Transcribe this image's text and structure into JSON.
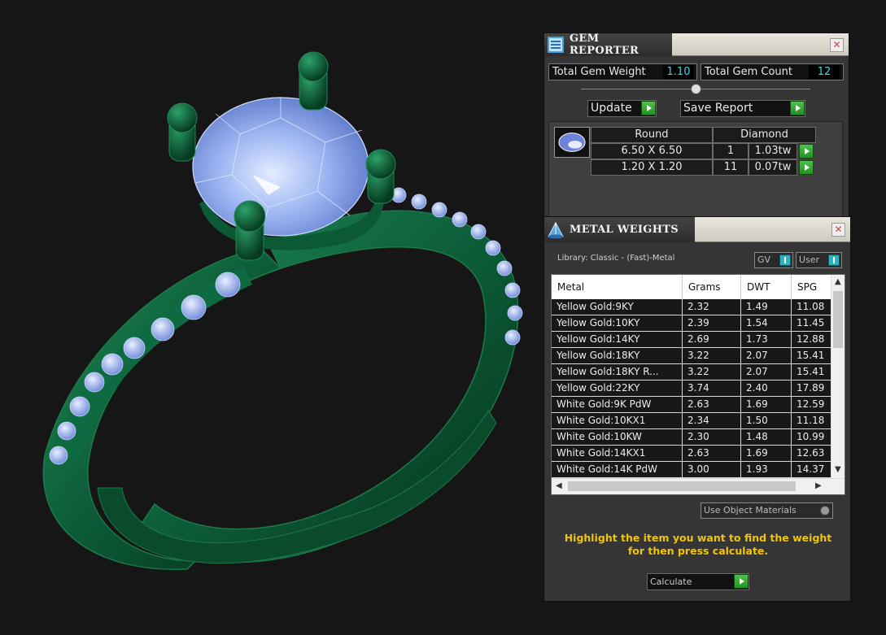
{
  "gem_reporter": {
    "title": "GEM REPORTER",
    "total_weight_label": "Total Gem Weight",
    "total_weight_value": "1.10",
    "total_count_label": "Total Gem Count",
    "total_count_value": "12",
    "update_label": "Update",
    "save_report_label": "Save Report",
    "stone_shape": "Round",
    "stone_type": "Diamond",
    "rows": [
      {
        "size": "6.50 X 6.50",
        "count": "1",
        "weight": "1.03tw"
      },
      {
        "size": "1.20 X 1.20",
        "count": "11",
        "weight": "0.07tw"
      }
    ]
  },
  "metal_weights": {
    "title": "METAL WEIGHTS",
    "library": "Library: Classic - (Fast)-Metal",
    "gv_label": "GV",
    "user_label": "User",
    "columns": [
      "Metal",
      "Grams",
      "DWT",
      "SPG"
    ],
    "rows": [
      [
        "Yellow Gold:9KY",
        "2.32",
        "1.49",
        "11.08"
      ],
      [
        "Yellow Gold:10KY",
        "2.39",
        "1.54",
        "11.45"
      ],
      [
        "Yellow Gold:14KY",
        "2.69",
        "1.73",
        "12.88"
      ],
      [
        "Yellow Gold:18KY",
        "3.22",
        "2.07",
        "15.41"
      ],
      [
        "Yellow Gold:18KY R...",
        "3.22",
        "2.07",
        "15.41"
      ],
      [
        "Yellow Gold:22KY",
        "3.74",
        "2.40",
        "17.89"
      ],
      [
        "White Gold:9K PdW",
        "2.63",
        "1.69",
        "12.59"
      ],
      [
        "White Gold:10KX1",
        "2.34",
        "1.50",
        "11.18"
      ],
      [
        "White Gold:10KW",
        "2.30",
        "1.48",
        "10.99"
      ],
      [
        "White Gold:14KX1",
        "2.63",
        "1.69",
        "12.63"
      ],
      [
        "White Gold:14K PdW",
        "3.00",
        "1.93",
        "14.37"
      ]
    ],
    "use_object_materials": "Use Object Materials",
    "instruction": "Highlight the item you want to find the weight for then press calculate.",
    "calculate_label": "Calculate"
  },
  "colors": {
    "metal_green": "#0e5e3a",
    "gem_blue": "#9fb8f5",
    "value_cyan": "#3ad8e6",
    "instruction_yellow": "#f2c500"
  }
}
